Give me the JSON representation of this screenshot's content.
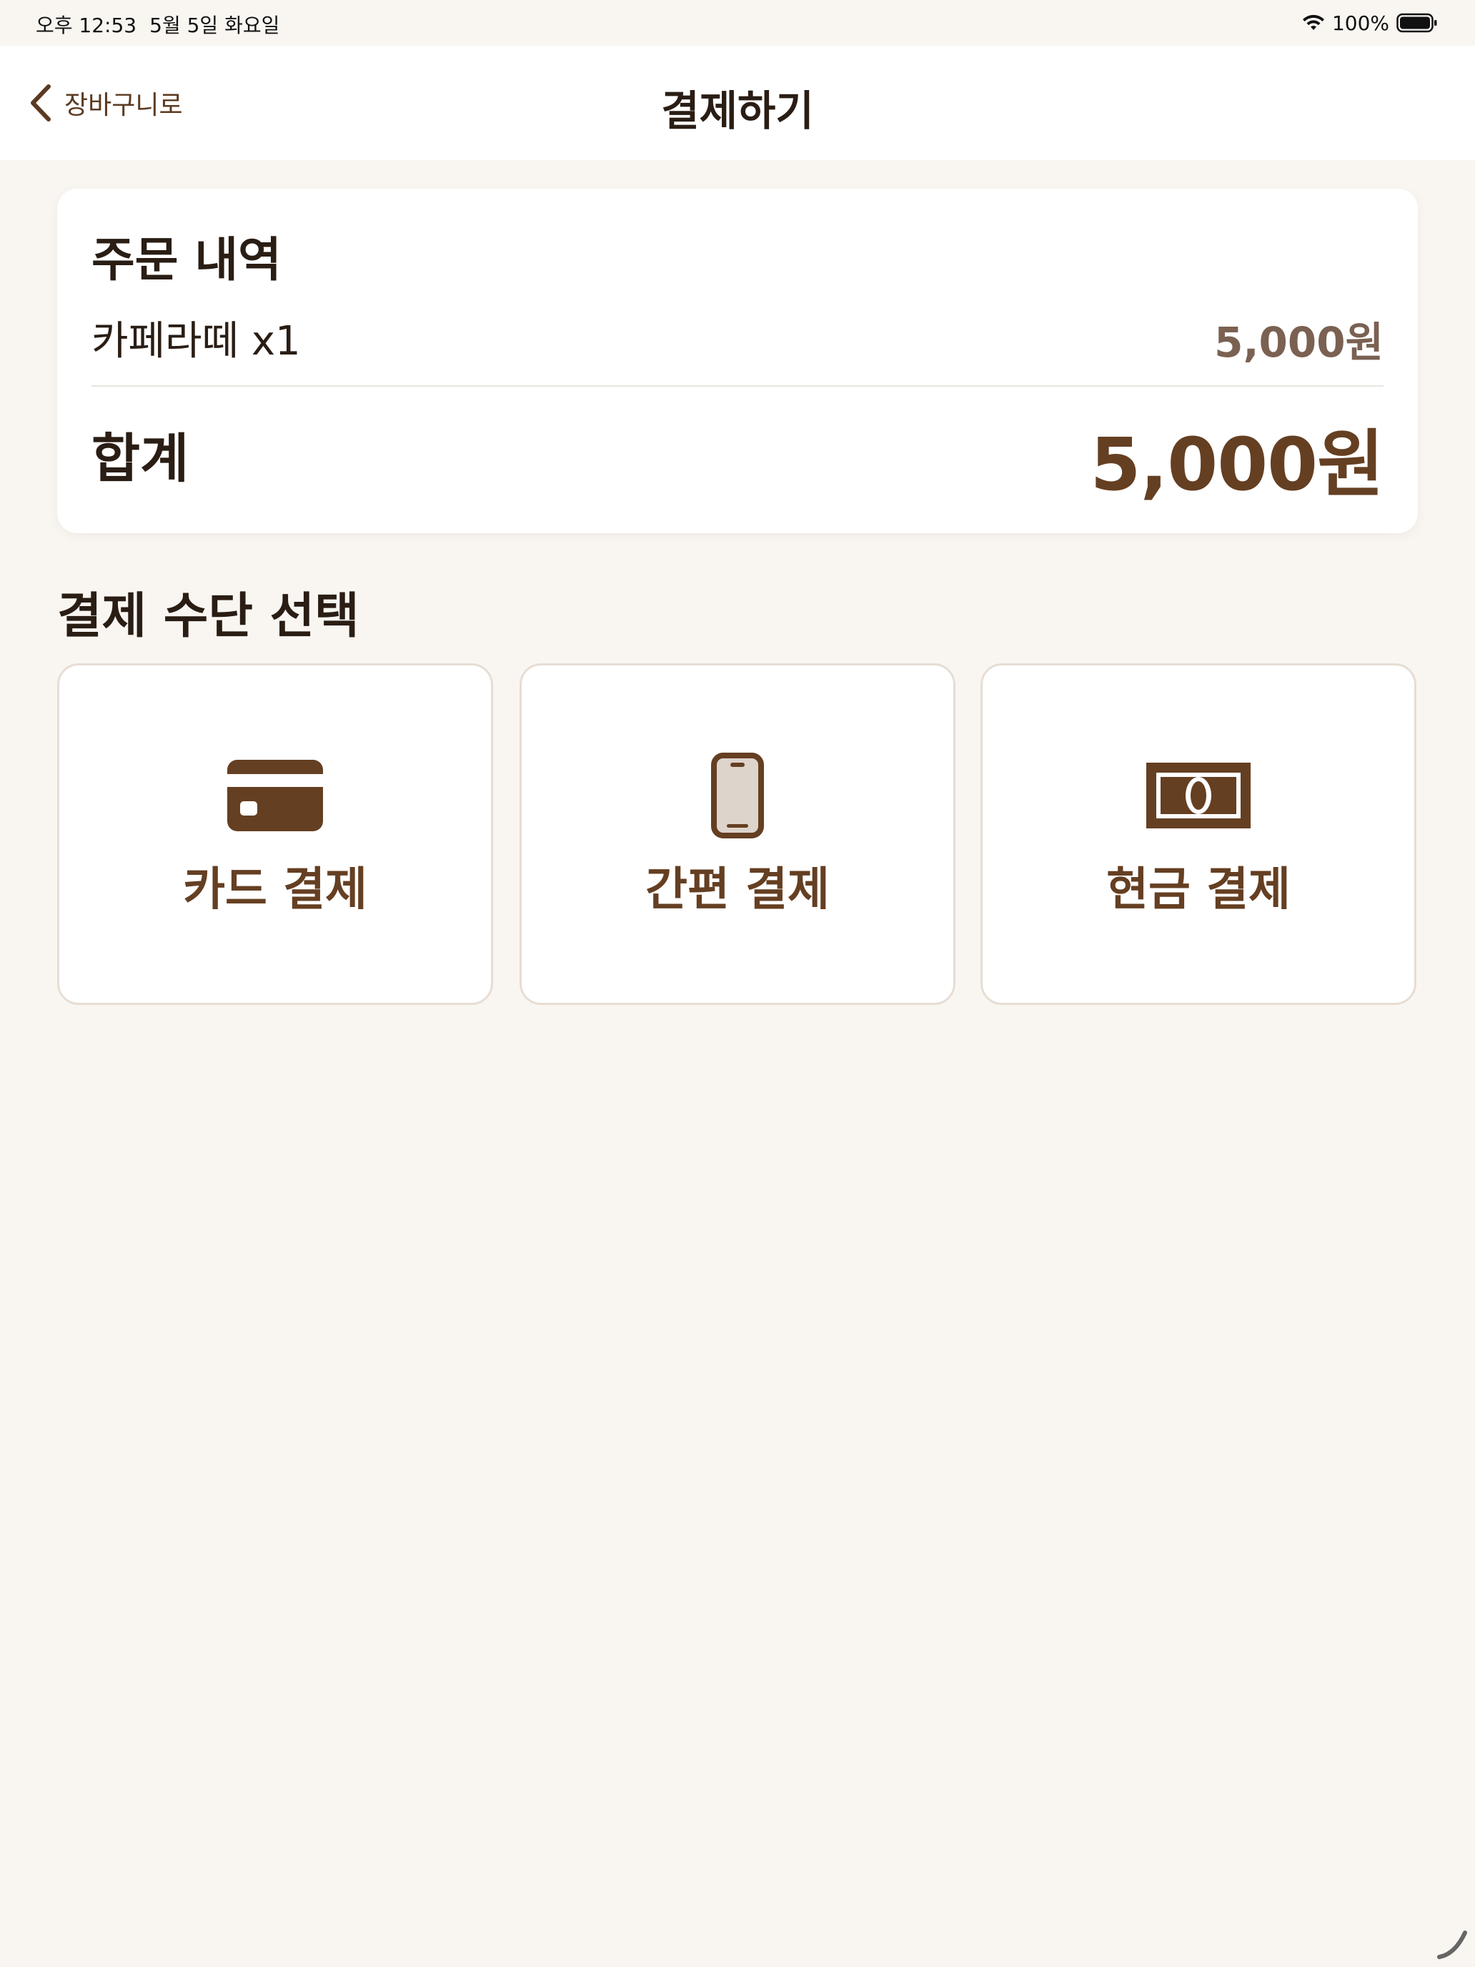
{
  "status_bar": {
    "time": "오후 12:53",
    "date": "5월 5일 화요일",
    "battery": "100%"
  },
  "nav": {
    "back_label": "장바구니로",
    "title": "결제하기"
  },
  "order": {
    "title": "주문 내역",
    "items": [
      {
        "name": "카페라떼 x1",
        "price": "5,000원"
      }
    ],
    "total_label": "합계",
    "total_value": "5,000원"
  },
  "payment": {
    "section_title": "결제 수단 선택",
    "options": [
      {
        "label": "카드 결제",
        "icon": "credit-card-icon"
      },
      {
        "label": "간편 결제",
        "icon": "smartphone-icon"
      },
      {
        "label": "현금 결제",
        "icon": "banknote-icon"
      }
    ]
  },
  "colors": {
    "background": "#f9f6f2",
    "card": "#ffffff",
    "accent_brown": "#653f22",
    "text_dark": "#2a1d14",
    "muted_price": "#7a6152",
    "border": "#e7ddd4"
  }
}
